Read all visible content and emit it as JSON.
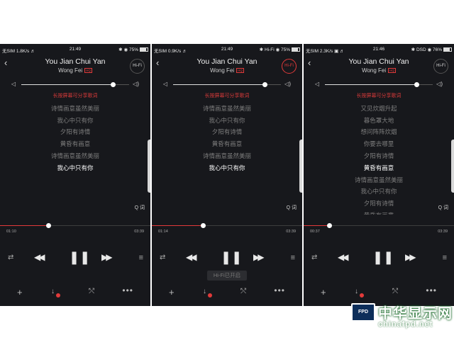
{
  "song": {
    "title": "You Jian Chui Yan",
    "artist": "Wong Fei",
    "quality_badge": "HQ"
  },
  "hifi_label": "Hi-Fi",
  "lyrics_hint": "长按屏幕可分享歌词",
  "lyric_search_label": "Q 词",
  "controls": {
    "repeat_icon": "⇄",
    "prev_icon": "◀◀",
    "pause_icon": "❚❚",
    "next_icon": "▶▶",
    "list_icon": "≡"
  },
  "bottom": {
    "add_icon": "+",
    "download_icon": "↓",
    "share_icon": "⤲",
    "more_icon": "•••"
  },
  "panels": [
    {
      "status": {
        "left": "无SIM 1.8K/s ♬",
        "time": "21:49",
        "right": "✱ ◉ 75%"
      },
      "hifi_active": false,
      "volume": 0.85,
      "lyrics": [
        "长按屏幕可分享歌词",
        "诗情画意虽然美丽",
        "我心中只有你",
        "夕阳有诗情",
        "黄昏有画意",
        "诗情画意虽然美丽",
        "我心中只有你"
      ],
      "current_line": 6,
      "progress": 0.32,
      "time_elapsed": "01:10",
      "time_total": "03:39",
      "toast": ""
    },
    {
      "status": {
        "left": "无SIM 0.9K/s ♬",
        "time": "21:49",
        "right": "✱ Hi-Fi ◉ 75%"
      },
      "hifi_active": true,
      "volume": 0.85,
      "lyrics": [
        "长按屏幕可分享歌词",
        "诗情画意虽然美丽",
        "我心中只有你",
        "夕阳有诗情",
        "黄昏有画意",
        "诗情画意虽然美丽",
        "我心中只有你"
      ],
      "current_line": 6,
      "progress": 0.34,
      "time_elapsed": "01:14",
      "time_total": "03:39",
      "toast": "Hi-Fi已开启"
    },
    {
      "status": {
        "left": "无SIM 2.3K/s ▣ ♬",
        "time": "21:46",
        "right": "✱ DSD ◉ 76%"
      },
      "hifi_active": false,
      "volume": 0.85,
      "lyrics": [
        "长按屏幕可分享歌词",
        "又见炊烟升起",
        "暮色罩大地",
        "想问阵阵炊烟",
        "你要去哪里",
        "夕阳有诗情",
        "黄昏有画意",
        "诗情画意虽然美丽",
        "我心中只有你",
        "夕阳有诗情",
        "黄昏有画意"
      ],
      "current_line": 6,
      "progress": 0.17,
      "time_elapsed": "00:37",
      "time_total": "03:39",
      "toast": ""
    }
  ],
  "watermark": {
    "badge": "FPD",
    "name": "中华显示网",
    "url": "chinafpd.net"
  }
}
